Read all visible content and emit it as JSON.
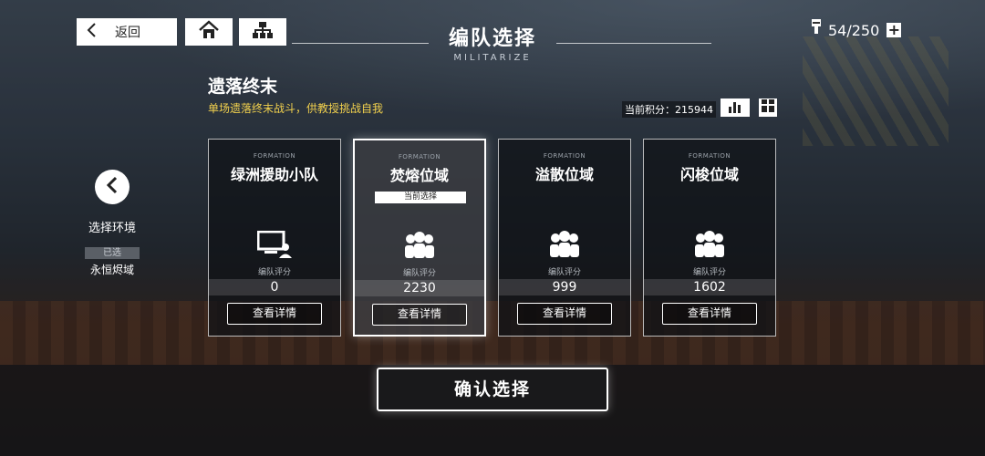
{
  "header": {
    "back_label": "返回",
    "title": "编队选择",
    "subtitle": "MILITARIZE",
    "stamina": "54/250",
    "stamina_plus": "+"
  },
  "stage": {
    "name": "遗落终末",
    "description": "单场遗落终末战斗，供教授挑战自我",
    "score_label": "当前积分：215944"
  },
  "environment": {
    "label": "选择环境",
    "badge": "已选",
    "value": "永恒烬域"
  },
  "cards": [
    {
      "formation": "FORMATION",
      "name": "绿洲援助小队",
      "icon": "computer-user-icon",
      "score_label": "编队评分",
      "score": "0",
      "detail": "查看详情",
      "selected": false
    },
    {
      "formation": "FORMATION",
      "name": "焚熔位域",
      "current": "当前选择",
      "icon": "group-icon",
      "score_label": "编队评分",
      "score": "2230",
      "detail": "查看详情",
      "selected": true
    },
    {
      "formation": "FORMATION",
      "name": "溢散位域",
      "icon": "group-icon",
      "score_label": "编队评分",
      "score": "999",
      "detail": "查看详情",
      "selected": false
    },
    {
      "formation": "FORMATION",
      "name": "闪梭位域",
      "icon": "group-icon",
      "score_label": "编队评分",
      "score": "1602",
      "detail": "查看详情",
      "selected": false
    }
  ],
  "confirm_label": "确认选择",
  "colors": {
    "accent_yellow": "#f2d14d",
    "panel": "#0f1216",
    "white": "#ffffff"
  }
}
